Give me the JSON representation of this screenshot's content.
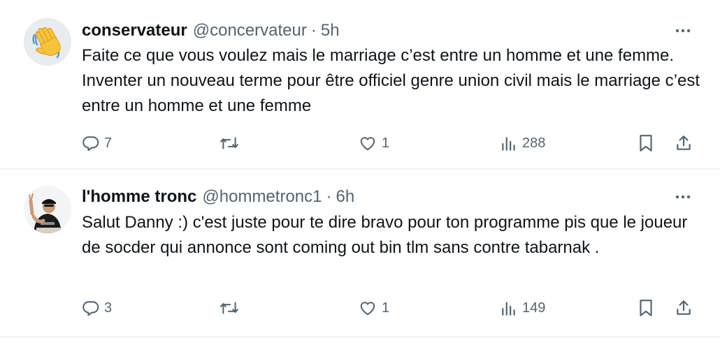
{
  "tweets": [
    {
      "display_name": "conservateur",
      "handle": "@concervateur",
      "separator": "·",
      "time": "5h",
      "avatar_icon": "waving-hand-emoji",
      "text": "Faite ce que vous voulez mais le marriage c’est entre un homme et une femme. Inventer un nouveau terme pour être officiel genre union civil mais le marriage c’est entre un homme et une femme",
      "replies": "7",
      "retweets": "",
      "likes": "1",
      "views": "288"
    },
    {
      "display_name": "l'homme tronc",
      "handle": "@hommetronc1",
      "separator": "·",
      "time": "6h",
      "avatar_icon": "person-peace-sign-photo",
      "text": "Salut Danny :) c'est juste pour te dire bravo pour ton programme pis que le joueur de socder qui annonce sont coming out bin tlm sans contre tabarnak .",
      "replies": "3",
      "retweets": "",
      "likes": "1",
      "views": "149"
    }
  ],
  "colors": {
    "text": "#0f1419",
    "secondary": "#536471",
    "divider": "#eff3f4",
    "background": "#ffffff"
  }
}
